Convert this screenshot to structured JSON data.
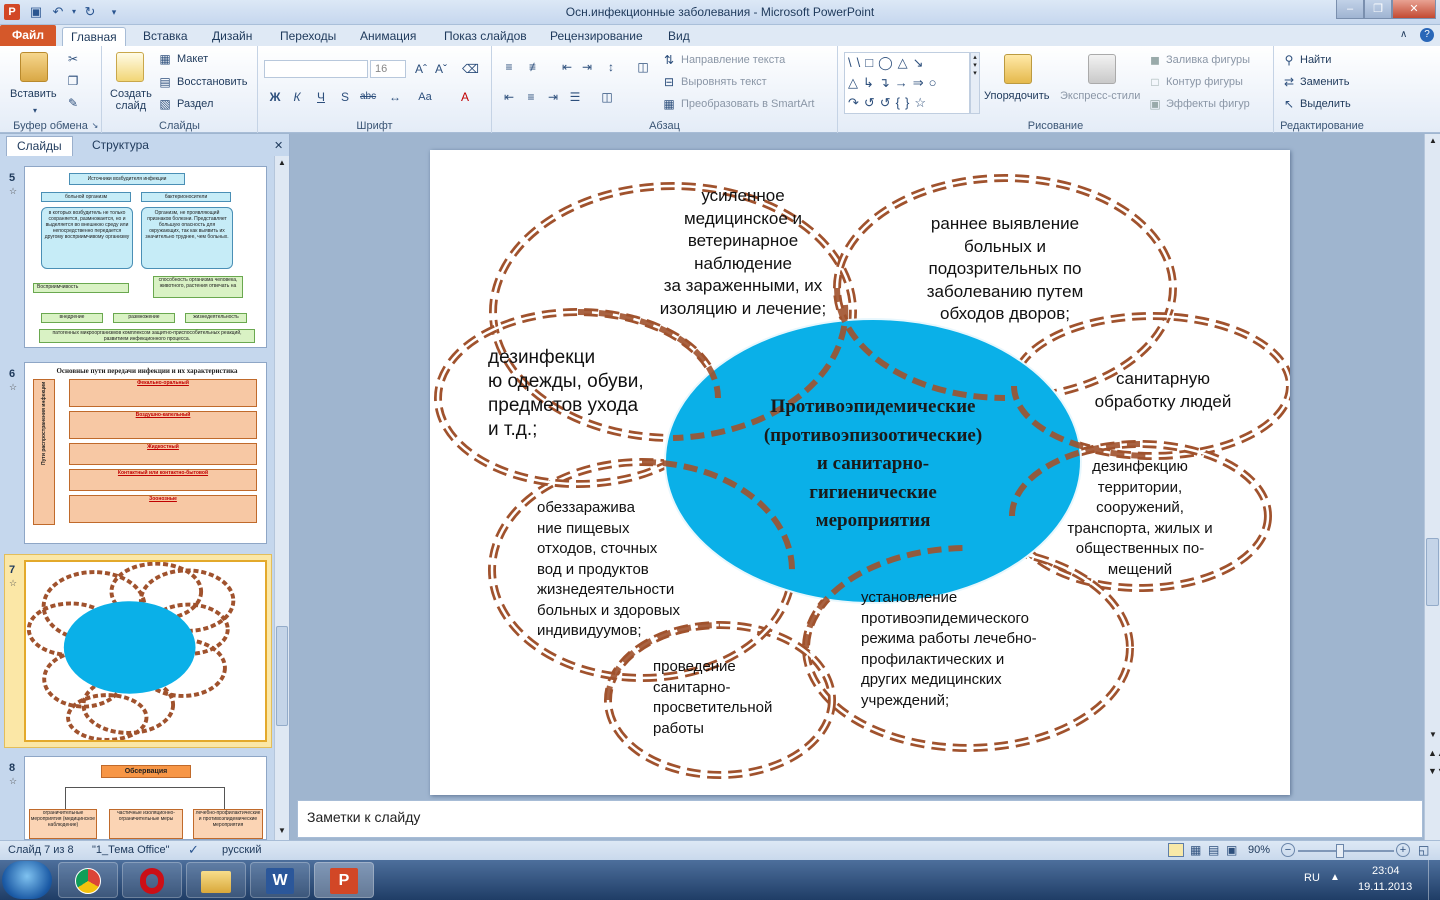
{
  "window": {
    "title": "Осн.инфекционные заболевания - Microsoft PowerPoint"
  },
  "tabs": [
    "Файл",
    "Главная",
    "Вставка",
    "Дизайн",
    "Переходы",
    "Анимация",
    "Показ слайдов",
    "Рецензирование",
    "Вид"
  ],
  "ribbon": {
    "clipboard": {
      "paste": "Вставить",
      "label": "Буфер обмена"
    },
    "slides": {
      "new_slide": "Создать\nслайд",
      "layout": "Макет",
      "reset": "Восстановить",
      "section": "Раздел",
      "label": "Слайды"
    },
    "font": {
      "size": "16",
      "label": "Шрифт"
    },
    "paragraph": {
      "text_direction": "Направление текста",
      "align_text": "Выровнять текст",
      "smartart": "Преобразовать в SmartArt",
      "label": "Абзац"
    },
    "drawing": {
      "arrange": "Упорядочить",
      "quick_styles": "Экспресс-стили",
      "fill": "Заливка фигуры",
      "outline": "Контур фигуры",
      "effects": "Эффекты фигур",
      "label": "Рисование"
    },
    "editing": {
      "find": "Найти",
      "replace": "Заменить",
      "select": "Выделить",
      "label": "Редактирование"
    }
  },
  "pane": {
    "tabs": [
      "Слайды",
      "Структура"
    ]
  },
  "thumbnails": [
    {
      "num": "5",
      "title": "Источники возбудителя инфекции",
      "texts": [
        "больной организм",
        "бактерионосители",
        "в которых возбудитель не только сохраняется, размножается, но и выделяется во внешнюю среду или непосредственно передается другому восприимчивому организму",
        "Организм, не проявляющий признаков болезни. Представляет большую опасность для окружающих, так как выявить их значительно труднее, чем больных.",
        "способность организма человека, животного, растения отвечать на",
        "Восприимчивость",
        "внедрение",
        "размножение",
        "жизнедеятельность",
        "патогенных микроорганизмов комплексом защитно-приспособительных реакций, развитием инфекционного процесса."
      ]
    },
    {
      "num": "6",
      "title": "Основные пути передачи инфекции и их характеристика",
      "side": "Пути распространения инфекции",
      "items": [
        "Фекально-оральный",
        "Воздушно-капельный",
        "Жидкостный",
        "Контактный или контактно-бытовой",
        "Зоонозные"
      ]
    },
    {
      "num": "7"
    },
    {
      "num": "8",
      "title": "Обсервация",
      "items": [
        "ограничительные мероприятия (медицинское наблюдение)",
        "частичные изоляционно-ограничительные меры",
        "лечебно-профилактические и противоэпидемические мероприятия"
      ]
    }
  ],
  "slide": {
    "center": "Противоэпидемические\n(противоэпизоотические)\nи санитарно-\nгигиенические\nмероприятия",
    "bubbles": [
      "усиленное\nмедицинское и\nветеринарное\nнаблюдение\nза зараженными, их\nизоляцию и лечение;",
      "раннее выявление\nбольных и\nподозрительных по\nзаболеванию путем\nобходов дворов;",
      "санитарную\nобработку людей",
      "дезинфекцию\nтерритории,\nсооружений,\nтранспорта, жилых и\nобщественных по-\nмещений",
      "установление\nпротивоэпидемического\nрежима работы лечебно-\nпрофилактических и\nдругих медицинских\nучреждений;",
      "проведение\nсанитарно-\nпросветительной\nработы",
      "обеззаражива\nние пищевых\nотходов, сточных\nвод и продуктов\nжизнедеятельности\nбольных и здоровых\nиндивидуумов;",
      "дезинфекци\nю одежды, обуви,\nпредметов ухода\nи т.д.;"
    ]
  },
  "notes": {
    "placeholder": "Заметки к слайду"
  },
  "status": {
    "slide": "Слайд 7 из 8",
    "theme": "\"1_Тема Office\"",
    "lang": "русский",
    "zoom": "90%",
    "zoom_fraction": 0.45
  },
  "taskbar": {
    "lang": "RU",
    "time": "23:04",
    "date": "19.11.2013"
  },
  "colors": {
    "accent_center": "#0ab0e8",
    "bubble_border": "#a0522d",
    "file_tab": "#d5582a"
  }
}
